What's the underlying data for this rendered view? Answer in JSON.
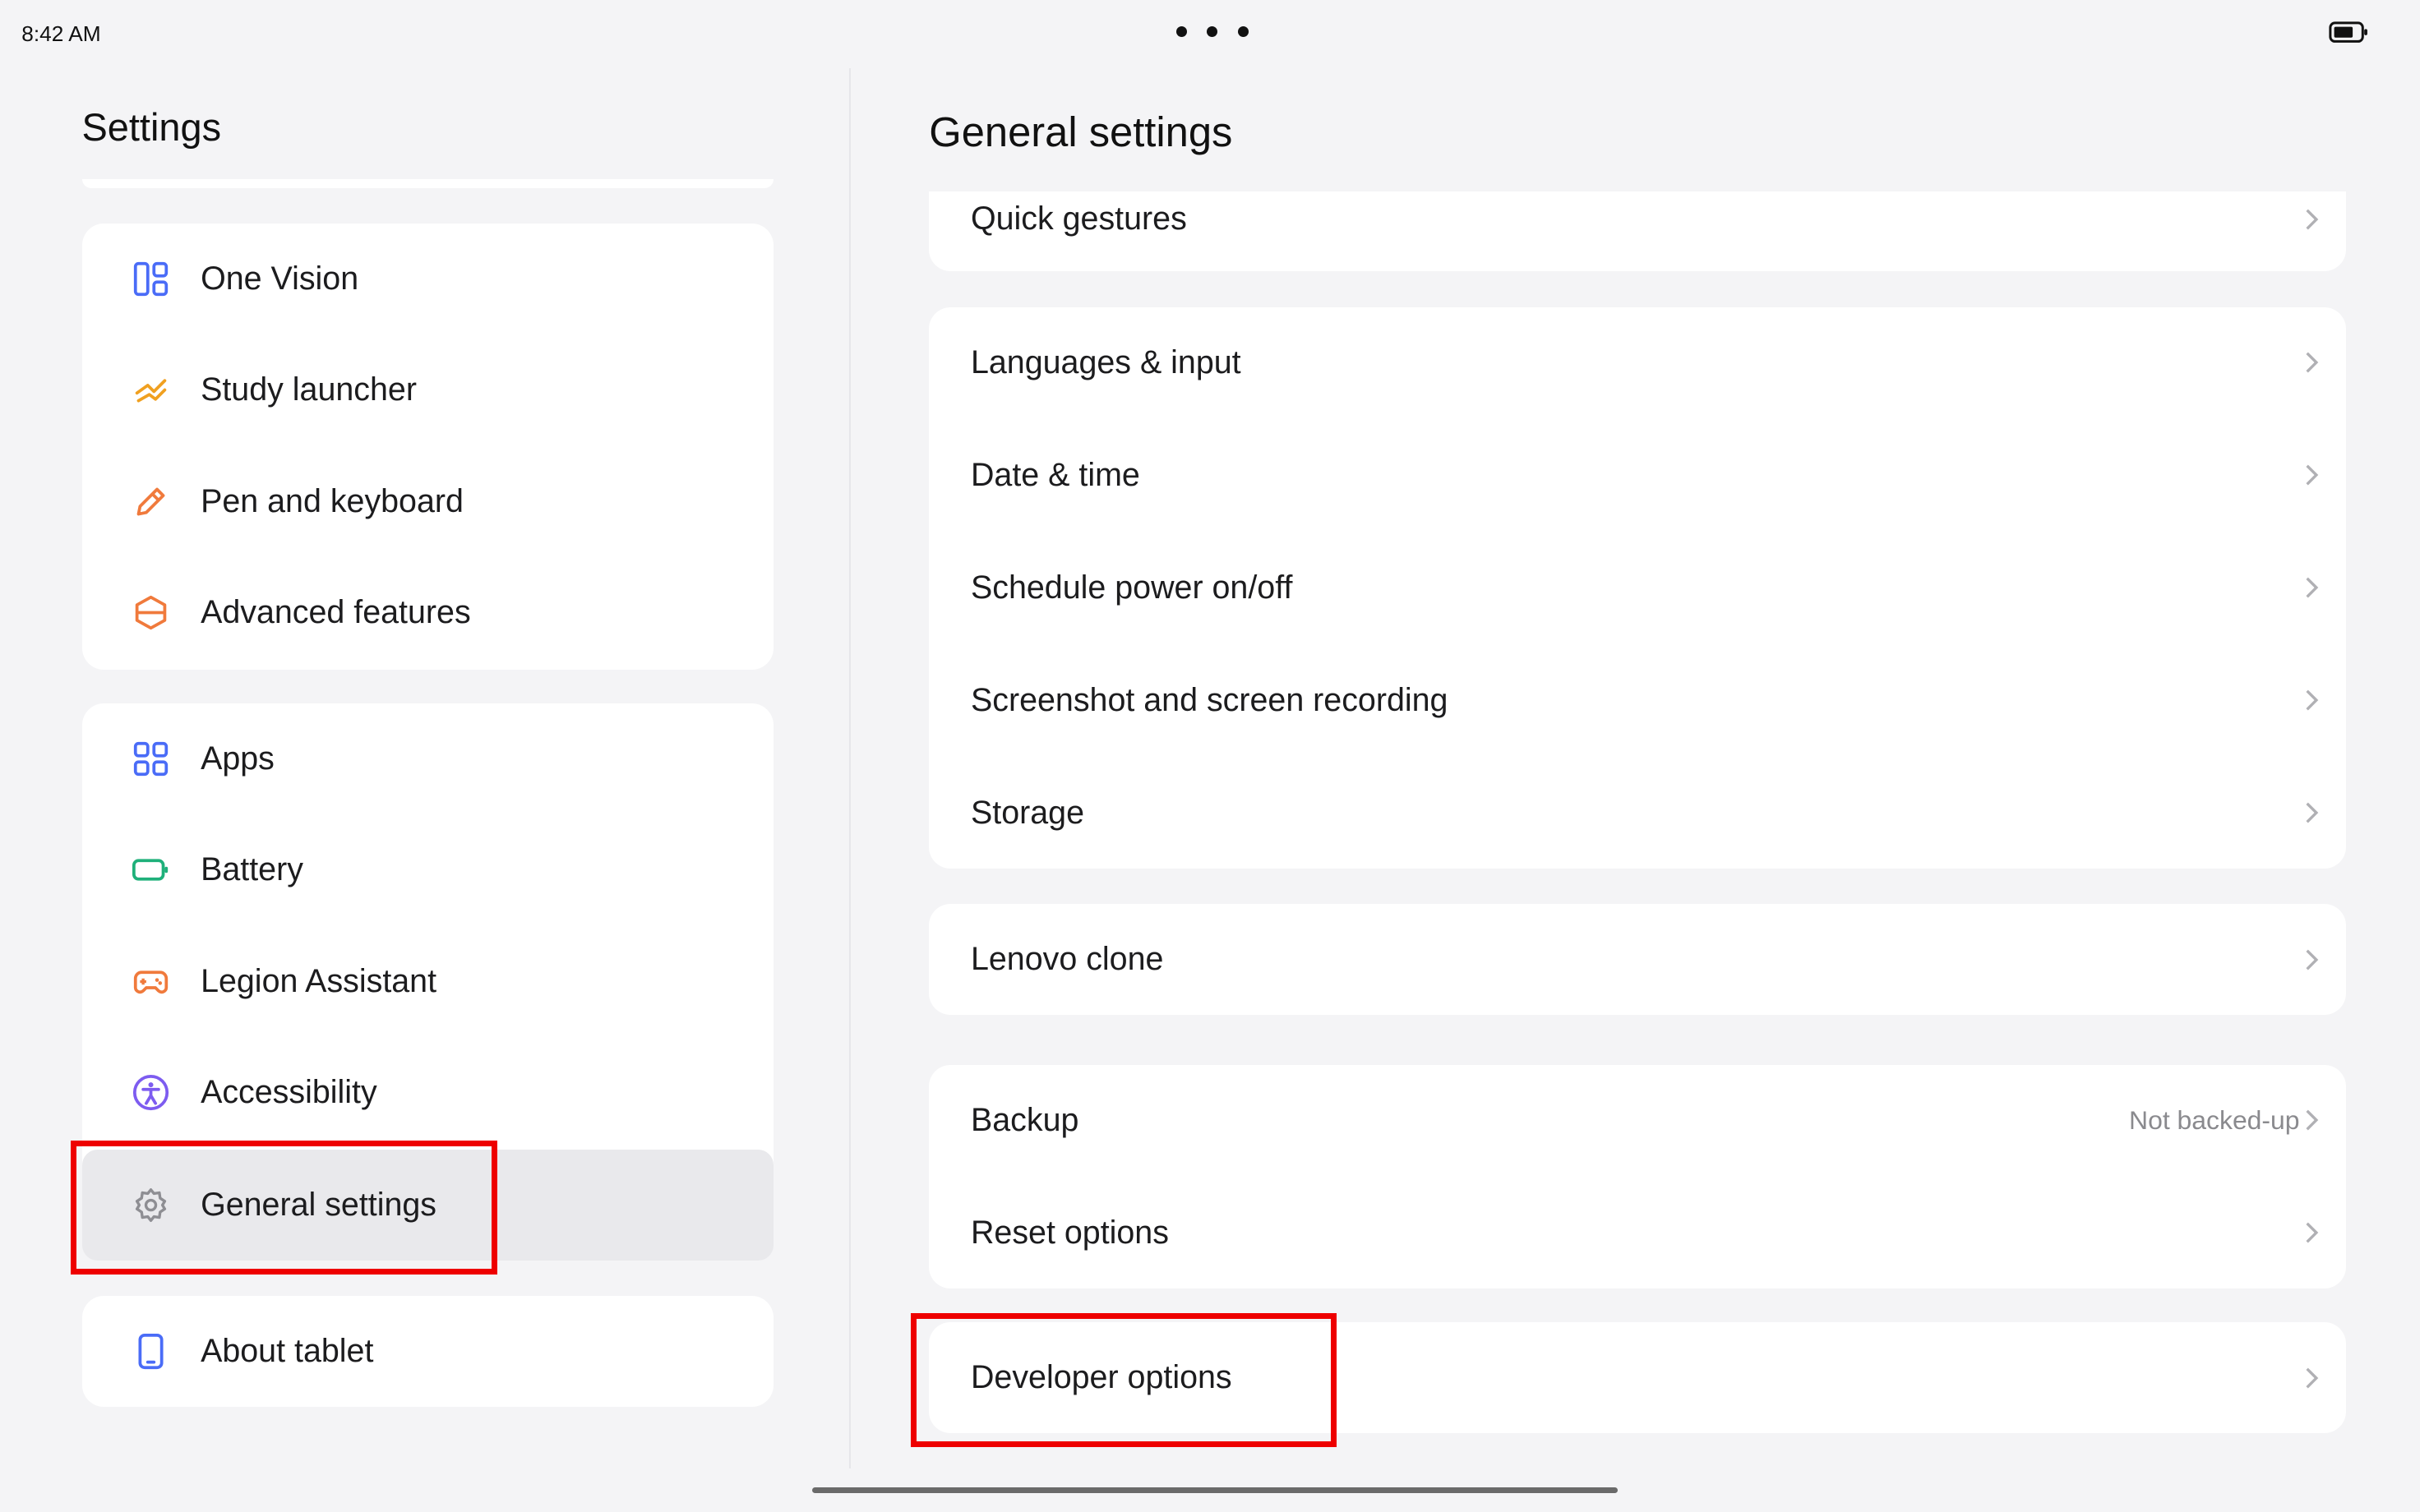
{
  "status": {
    "time": "8:42 AM"
  },
  "sidebar": {
    "title": "Settings",
    "groups": [
      {
        "items": [
          {
            "label": "One Vision",
            "icon": "one-vision-icon"
          },
          {
            "label": "Study launcher",
            "icon": "study-launcher-icon"
          },
          {
            "label": "Pen and keyboard",
            "icon": "pen-icon"
          },
          {
            "label": "Advanced features",
            "icon": "advanced-features-icon"
          }
        ]
      },
      {
        "items": [
          {
            "label": "Apps",
            "icon": "apps-grid-icon"
          },
          {
            "label": "Battery",
            "icon": "battery-icon"
          },
          {
            "label": "Legion Assistant",
            "icon": "gamepad-icon"
          },
          {
            "label": "Accessibility",
            "icon": "accessibility-icon"
          },
          {
            "label": "General settings",
            "icon": "gear-icon",
            "selected": true
          }
        ]
      },
      {
        "items": [
          {
            "label": "About tablet",
            "icon": "tablet-icon"
          }
        ]
      }
    ]
  },
  "main": {
    "title": "General settings",
    "groups": [
      {
        "items": [
          {
            "label": "Quick gestures"
          }
        ]
      },
      {
        "items": [
          {
            "label": "Languages & input"
          },
          {
            "label": "Date & time"
          },
          {
            "label": "Schedule power on/off"
          },
          {
            "label": "Screenshot and screen recording"
          },
          {
            "label": "Storage"
          }
        ]
      },
      {
        "items": [
          {
            "label": "Lenovo clone"
          }
        ]
      },
      {
        "items": [
          {
            "label": "Backup",
            "value": "Not backed-up"
          },
          {
            "label": "Reset options"
          }
        ]
      },
      {
        "items": [
          {
            "label": "Developer options"
          }
        ]
      }
    ]
  },
  "colors": {
    "highlight": "#ee0000",
    "accent_blue": "#4a6cf7",
    "accent_orange": "#f08a3c",
    "accent_green": "#1fb07a",
    "accent_purple": "#7d5cf0"
  }
}
